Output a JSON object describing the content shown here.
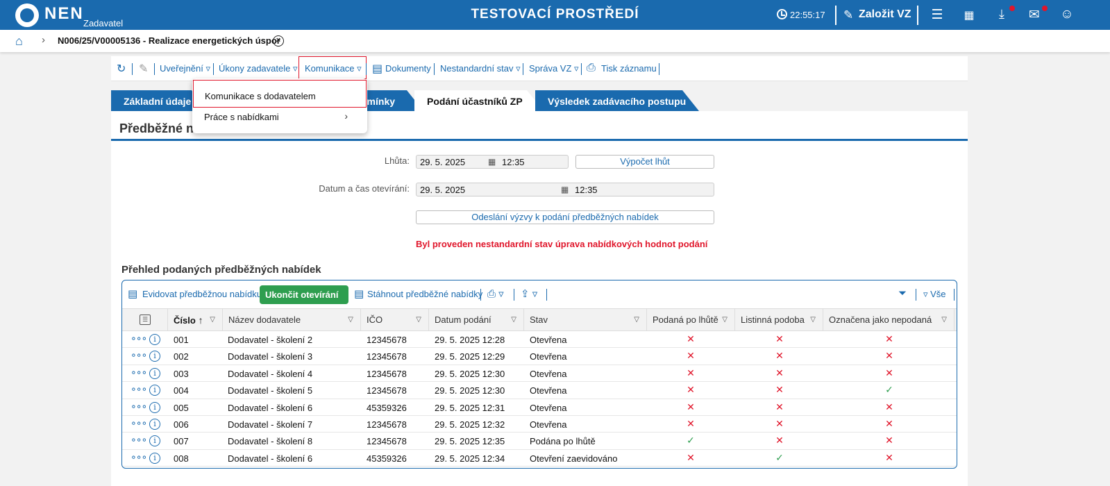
{
  "topbar": {
    "brand": "NEN",
    "brand_sub": "Zadavatel",
    "env_title": "TESTOVACÍ PROSTŘEDÍ",
    "time": "22:55:17",
    "new_vz": "Založit VZ",
    "icons": [
      "clock-icon",
      "edit-icon",
      "menu-icon",
      "calendar-icon",
      "download-icon",
      "mail-icon",
      "user-icon"
    ]
  },
  "breadcrumb": {
    "text": "N006/25/V00005136 - Realizace energetických úspor",
    "close_glyph": "×"
  },
  "toolbar": {
    "items": [
      "Uveřejnění ▿",
      "Úkony zadavatele ▿",
      "Komunikace ▿",
      "Dokumenty",
      "Nestandardní stav ▿",
      "Správa VZ ▿",
      "Tisk záznamu"
    ]
  },
  "dropdown": {
    "item1": "Komunikace s dodavatelem",
    "item2": "Práce s nabídkami"
  },
  "tabs": [
    "Základní údaje",
    "dmínky",
    "Podání účastníků ZP",
    "Výsledek zadávacího postupu"
  ],
  "main": {
    "title": "Předběžné na",
    "lhuta_label": "Lhůta:",
    "lhuta_date": "29. 5. 2025",
    "lhuta_time": "12:35",
    "vypocet": "Výpočet lhůt",
    "otevreni_label": "Datum a čas otevírání:",
    "otevreni_date": "29. 5. 2025",
    "otevreni_time": "12:35",
    "odeslani": "Odeslání výzvy k podání předběžných nabídek",
    "warning": "Byl proveden nestandardní stav úprava nabídkových hodnot podání",
    "section_title": "Přehled podaných předběžných nabídek"
  },
  "grid": {
    "tools": {
      "evidovat": "Evidovat předběžnou nabídku",
      "ukoncit": "Ukončit otevírání",
      "stahnout": "Stáhnout předběžné nabídky",
      "vse": "▿ Vše"
    },
    "columns": [
      "Číslo",
      "Název dodavatele",
      "IČO",
      "Datum podání",
      "Stav",
      "Podaná po lhůtě",
      "Listinná podoba",
      "Označena jako nepodaná"
    ],
    "rows": [
      {
        "cislo": "001",
        "nazev": "Dodavatel - školení 2",
        "ico": "12345678",
        "datum": "29. 5. 2025 12:28",
        "stav": "Otevřena",
        "po_lhute": false,
        "listinna": false,
        "nepodana": false
      },
      {
        "cislo": "002",
        "nazev": "Dodavatel - školení 3",
        "ico": "12345678",
        "datum": "29. 5. 2025 12:29",
        "stav": "Otevřena",
        "po_lhute": false,
        "listinna": false,
        "nepodana": false
      },
      {
        "cislo": "003",
        "nazev": "Dodavatel - školení 4",
        "ico": "12345678",
        "datum": "29. 5. 2025 12:30",
        "stav": "Otevřena",
        "po_lhute": false,
        "listinna": false,
        "nepodana": false
      },
      {
        "cislo": "004",
        "nazev": "Dodavatel - školení 5",
        "ico": "12345678",
        "datum": "29. 5. 2025 12:30",
        "stav": "Otevřena",
        "po_lhute": false,
        "listinna": false,
        "nepodana": true
      },
      {
        "cislo": "005",
        "nazev": "Dodavatel - školení 6",
        "ico": "45359326",
        "datum": "29. 5. 2025 12:31",
        "stav": "Otevřena",
        "po_lhute": false,
        "listinna": false,
        "nepodana": false
      },
      {
        "cislo": "006",
        "nazev": "Dodavatel - školení 7",
        "ico": "12345678",
        "datum": "29. 5. 2025 12:32",
        "stav": "Otevřena",
        "po_lhute": false,
        "listinna": false,
        "nepodana": false
      },
      {
        "cislo": "007",
        "nazev": "Dodavatel - školení 8",
        "ico": "12345678",
        "datum": "29. 5. 2025 12:35",
        "stav": "Podána po lhůtě",
        "po_lhute": true,
        "listinna": false,
        "nepodana": false
      },
      {
        "cislo": "008",
        "nazev": "Dodavatel - školení 6",
        "ico": "45359326",
        "datum": "29. 5. 2025 12:34",
        "stav": "Otevření zaevidováno",
        "po_lhute": false,
        "listinna": true,
        "nepodana": false
      }
    ]
  },
  "colors": {
    "primary": "#1a6aae",
    "danger": "#e0162b",
    "success": "#2e9e4f"
  }
}
